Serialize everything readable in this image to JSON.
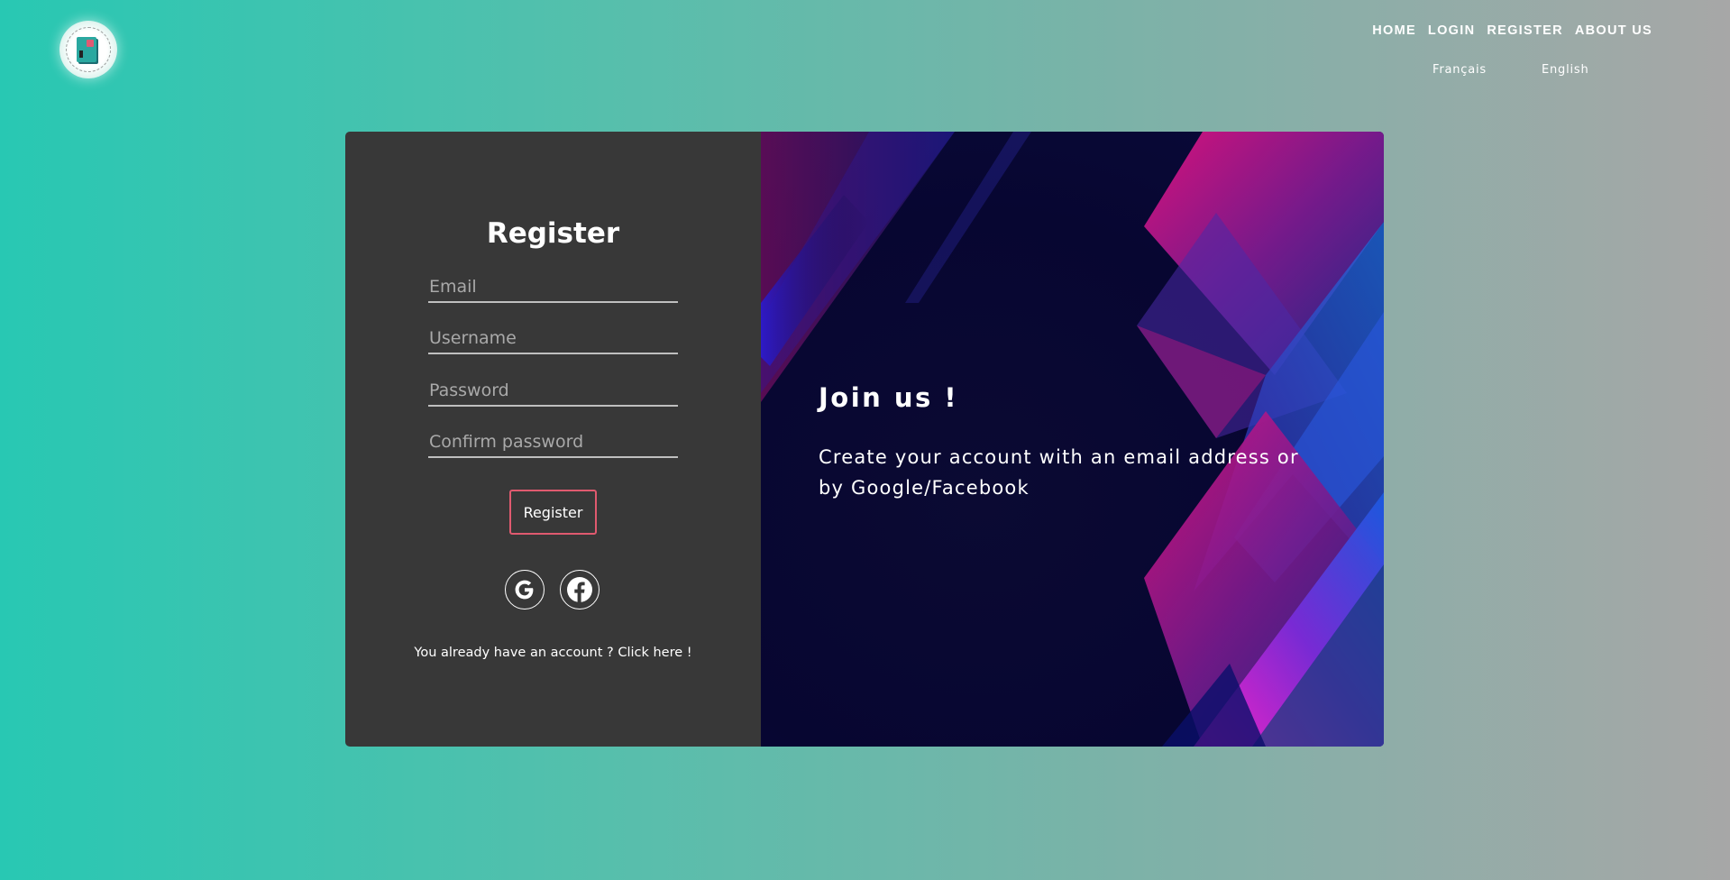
{
  "header": {
    "logo_icon": "book-logo-icon",
    "nav": [
      {
        "label": "HOME"
      },
      {
        "label": "LOGIN"
      },
      {
        "label": "REGISTER"
      },
      {
        "label": "ABOUT US"
      }
    ],
    "languages": [
      {
        "label": "Français"
      },
      {
        "label": "English"
      }
    ]
  },
  "form": {
    "title": "Register",
    "email_placeholder": "Email",
    "username_placeholder": "Username",
    "password_placeholder": "Password",
    "confirm_placeholder": "Confirm password",
    "submit_label": "Register",
    "social": [
      {
        "name": "google-icon"
      },
      {
        "name": "facebook-icon"
      }
    ],
    "already_text": "You already have an account ? ",
    "already_link": "Click here !"
  },
  "promo": {
    "title": "Join us !",
    "text": "Create your account with an email address or by Google/Facebook"
  },
  "colors": {
    "accent": "#e05a6f",
    "panel": "#383838",
    "background_start": "#28c8b3",
    "background_end": "#a7a7a7"
  }
}
